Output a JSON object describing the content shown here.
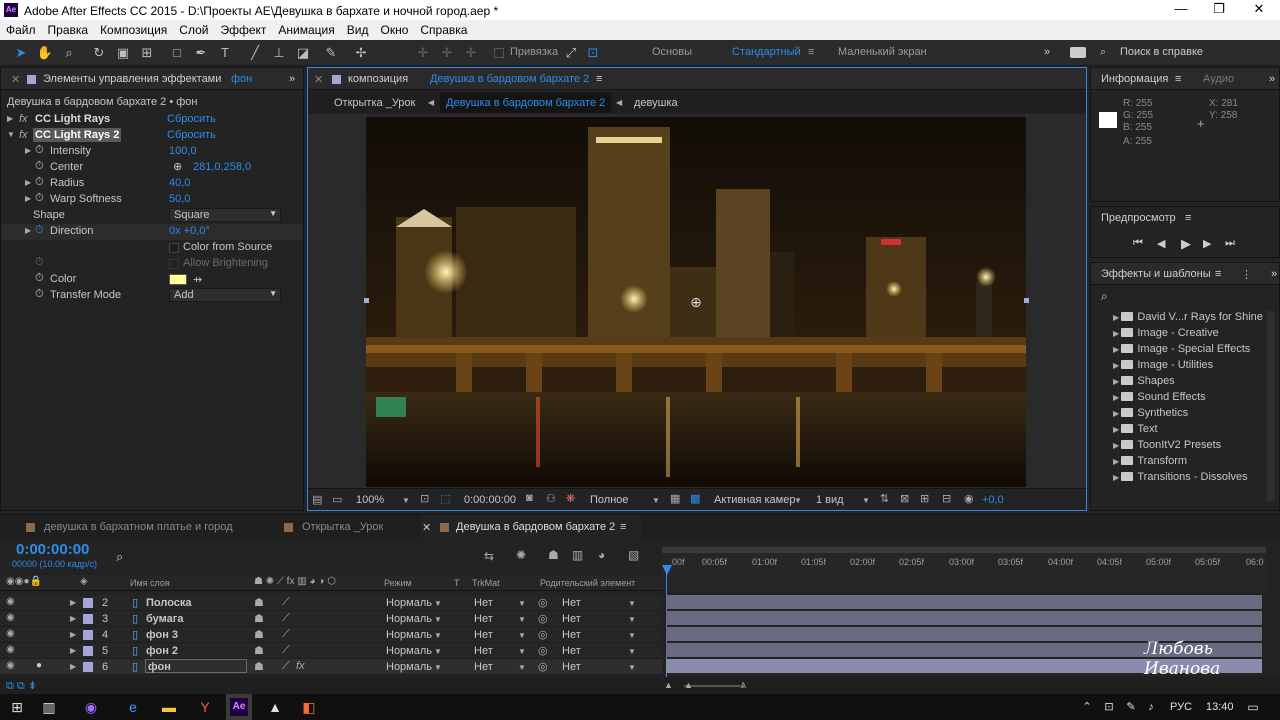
{
  "window": {
    "logo": "Ae",
    "title": "Adobe After Effects CC 2015 - D:\\Проекты AE\\Девушка в бархате и ночной город.aep *",
    "min": "—",
    "max": "❐",
    "close": "✕"
  },
  "menu": [
    "Файл",
    "Правка",
    "Композиция",
    "Слой",
    "Эффект",
    "Анимация",
    "Вид",
    "Окно",
    "Справка"
  ],
  "toolbar": {
    "snap_label": "Привязка",
    "workspaces": [
      "Основы",
      "Стандартный",
      "Маленький экран"
    ],
    "active_workspace": "Стандартный",
    "search_label": "Поиск в справке"
  },
  "effect_controls": {
    "title_prefix": "Элементы управления эффектами",
    "title_layer": "фон",
    "subtitle": "Девушка в бардовом бархате 2 • фон",
    "effects": [
      {
        "fx": "fx",
        "name": "CC Light Rays",
        "reset": "Сбросить"
      },
      {
        "fx": "fx",
        "name": "CC Light Rays 2",
        "reset": "Сбросить"
      }
    ],
    "params": {
      "intensity": {
        "label": "Intensity",
        "value": "100,0"
      },
      "center": {
        "label": "Center",
        "value": "281,0,258,0"
      },
      "radius": {
        "label": "Radius",
        "value": "40,0"
      },
      "warp": {
        "label": "Warp Softness",
        "value": "50,0"
      },
      "shape": {
        "label": "Shape",
        "value": "Square"
      },
      "direction": {
        "label": "Direction",
        "value": "0x +0,0°"
      },
      "color_from_source": "Color from Source",
      "allow_brightening": "Allow Brightening",
      "color": {
        "label": "Color",
        "value": "#ffff99"
      },
      "transfer": {
        "label": "Transfer Mode",
        "value": "Add"
      }
    }
  },
  "composition": {
    "title_prefix": "композиция",
    "title_name": "Девушка в бардовом бархате 2",
    "breadcrumbs": [
      "Открытка _Урок",
      "Девушка в бардовом бархате 2",
      "девушка"
    ],
    "zoom": "100%",
    "timecode": "0:00:00:00",
    "resolution": "Полное",
    "camera": "Активная камер",
    "views": "1 вид",
    "exposure": "+0,0"
  },
  "info": {
    "tab": "Информация",
    "tab2": "Аудио",
    "r": "R:  255",
    "g": "G:  255",
    "b": "B:  255",
    "a": "A:  255",
    "x": "X:  281",
    "y": "Y:  258"
  },
  "preview": {
    "title": "Предпросмотр"
  },
  "effects_presets": {
    "title": "Эффекты и шаблоны",
    "items": [
      "David V...r Rays for Shine",
      "Image - Creative",
      "Image - Special Effects",
      "Image - Utilities",
      "Shapes",
      "Sound Effects",
      "Synthetics",
      "Text",
      "ToonItV2 Presets",
      "Transform",
      "Transitions - Dissolves"
    ]
  },
  "timeline": {
    "tabs": [
      "девушка в бархатном платье и город",
      "Открытка _Урок",
      "Девушка в бардовом бархате 2"
    ],
    "timecode": "0:00:00:00",
    "fps": "00000 (10.00 кадр/с)",
    "col_layer_name": "Имя слоя",
    "col_mode": "Режим",
    "col_t": "T",
    "col_trkmat": "TrkMat",
    "col_parent": "Родительский элемент",
    "ruler": [
      "00f",
      "00:05f",
      "01:00f",
      "01:05f",
      "02:00f",
      "02:05f",
      "03:00f",
      "03:05f",
      "04:00f",
      "04:05f",
      "05:00f",
      "05:05f",
      "06:0"
    ],
    "layers": [
      {
        "num": "2",
        "name": "Полоска",
        "mode": "Нормаль",
        "trkmat": "Нет",
        "parent": "Нет"
      },
      {
        "num": "3",
        "name": "бумага",
        "mode": "Нормаль",
        "trkmat": "Нет",
        "parent": "Нет"
      },
      {
        "num": "4",
        "name": "фон 3",
        "mode": "Нормаль",
        "trkmat": "Нет",
        "parent": "Нет"
      },
      {
        "num": "5",
        "name": "фон 2",
        "mode": "Нормаль",
        "trkmat": "Нет",
        "parent": "Нет"
      },
      {
        "num": "6",
        "name": "фон",
        "mode": "Нормаль",
        "trkmat": "Нет",
        "parent": "Нет"
      }
    ]
  },
  "watermark": "Любовь Иванова",
  "tray": {
    "lang": "РУС",
    "time": "13:40"
  }
}
